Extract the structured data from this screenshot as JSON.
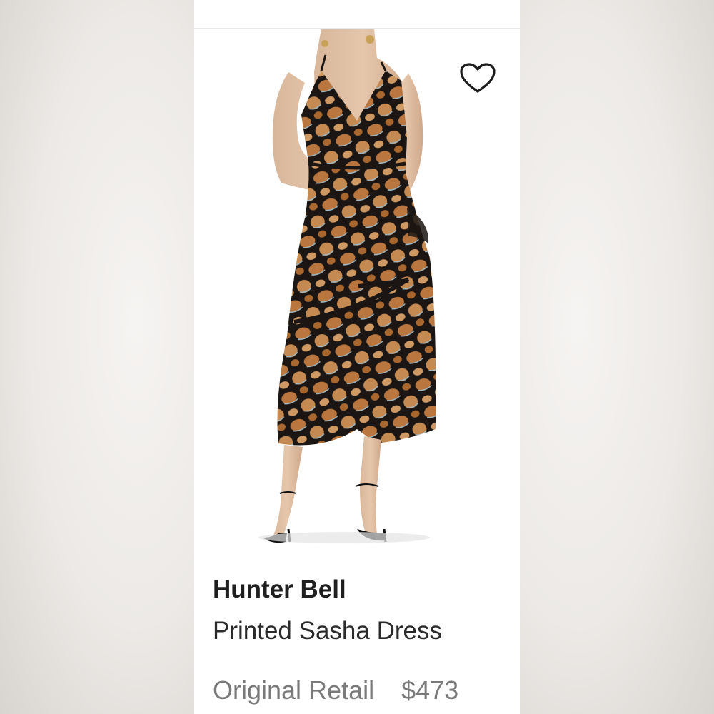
{
  "product": {
    "brand": "Hunter Bell",
    "name": "Printed Sasha Dress",
    "retail_label": "Original Retail",
    "retail_price": "$473"
  },
  "icons": {
    "favorite": "heart-outline-icon"
  },
  "colors": {
    "card_bg": "#ffffff",
    "brand_text": "#1f1f1f",
    "muted_text": "#7a7a7a",
    "dress_base": "#1b1613",
    "dress_print": "#b9763e"
  }
}
